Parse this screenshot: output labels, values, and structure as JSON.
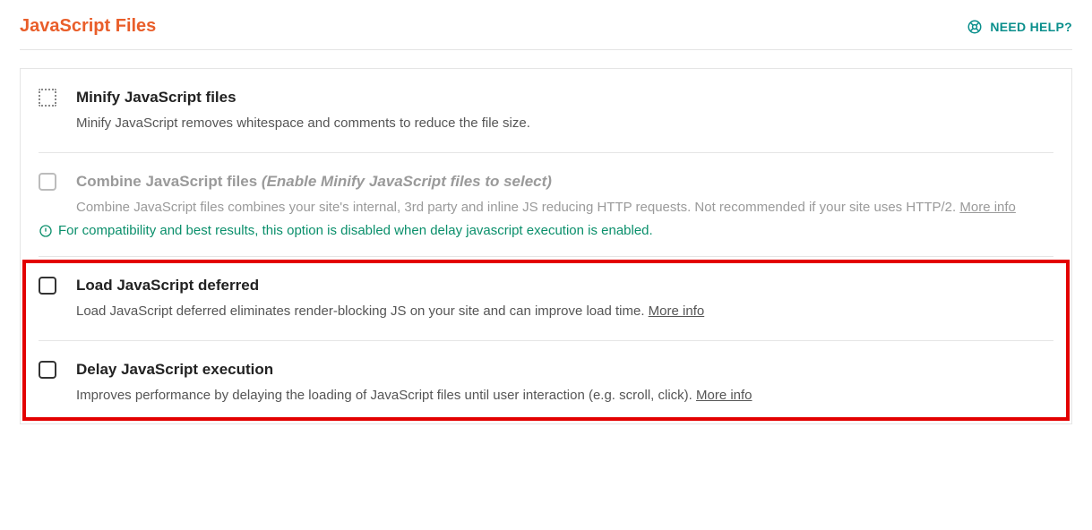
{
  "section_title": "JavaScript Files",
  "help_label": "NEED HELP?",
  "options": {
    "minify": {
      "label": "Minify JavaScript files",
      "desc": "Minify JavaScript removes whitespace and comments to reduce the file size."
    },
    "combine": {
      "label": "Combine JavaScript files ",
      "condition": "(Enable Minify JavaScript files to select)",
      "desc": "Combine JavaScript files combines your site's internal, 3rd party and inline JS reducing HTTP requests. Not recommended if your site uses HTTP/2. ",
      "more": "More info",
      "note": "For compatibility and best results, this option is disabled when delay javascript execution is enabled."
    },
    "defer": {
      "label": "Load JavaScript deferred",
      "desc": "Load JavaScript deferred eliminates render-blocking JS on your site and can improve load time. ",
      "more": "More info"
    },
    "delay": {
      "label": "Delay JavaScript execution",
      "desc": "Improves performance by delaying the loading of JavaScript files until user interaction (e.g. scroll, click). ",
      "more": "More info"
    }
  }
}
